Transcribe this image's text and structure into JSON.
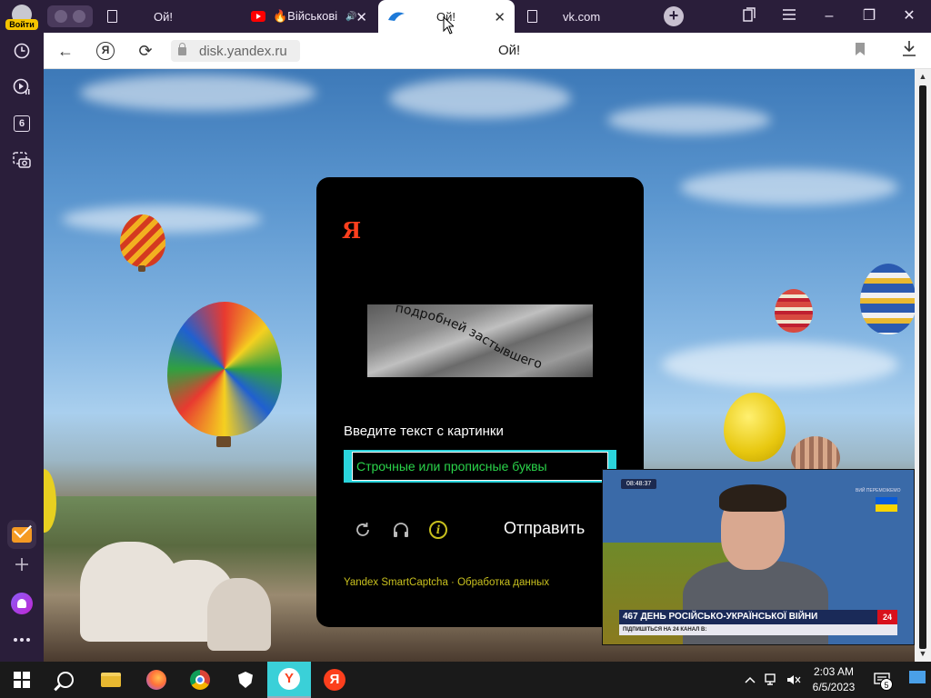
{
  "sidebar": {
    "login_label": "Войти",
    "history_icon": "clock-icon",
    "media_icon": "play-icon",
    "tabs_count": "6",
    "screenshot_icon": "camera-icon",
    "mail_icon": "mail-icon",
    "add_icon": "plus-icon",
    "alice_icon": "alice-icon",
    "more_icon": "more-icon"
  },
  "tabs": [
    {
      "title": "Ой!",
      "icon": "doc-icon"
    },
    {
      "title": "🔥Військові",
      "icon": "youtube-icon",
      "audio": "🔊"
    },
    {
      "title": "Ой!",
      "icon": "yandex-icon",
      "active": true
    },
    {
      "title": "vk.com",
      "icon": "doc-icon"
    }
  ],
  "window": {
    "new_tab": "+",
    "minimize": "–",
    "restore": "❐",
    "close": "✕"
  },
  "toolbar": {
    "back": "←",
    "ya": "Я",
    "reload": "⟳",
    "url": "disk.yandex.ru",
    "page_title": "Ой!"
  },
  "captcha": {
    "logo": "Я",
    "distorted_text": "подробней застывшего",
    "label": "Введите текст с картинки",
    "placeholder": "Строчные или прописные буквы",
    "submit": "Отправить",
    "footer_brand": "Yandex SmartCaptcha",
    "footer_sep": " · ",
    "footer_link": "Обработка данных"
  },
  "pip": {
    "time": "08:48:37",
    "corner_label": "ВИЙ ПЕРЕМОЖЕМО",
    "headline": "467 ДЕНЬ РОСІЙСЬКО-УКРАЇНСЬКОЇ ВІЙНИ",
    "ticker": "ПІДПИШІТЬСЯ НА 24 КАНАЛ В:",
    "channel": "24"
  },
  "taskbar": {
    "time": "2:03 AM",
    "date": "6/5/2023",
    "notifications": "5"
  },
  "colors": {
    "sidebar_bg": "#2a1e3a",
    "yandex_red": "#fc3f1d",
    "captcha_accent": "#2ad4dc",
    "captcha_text_green": "#2ad44a",
    "footer_yellow": "#c8c01e"
  }
}
